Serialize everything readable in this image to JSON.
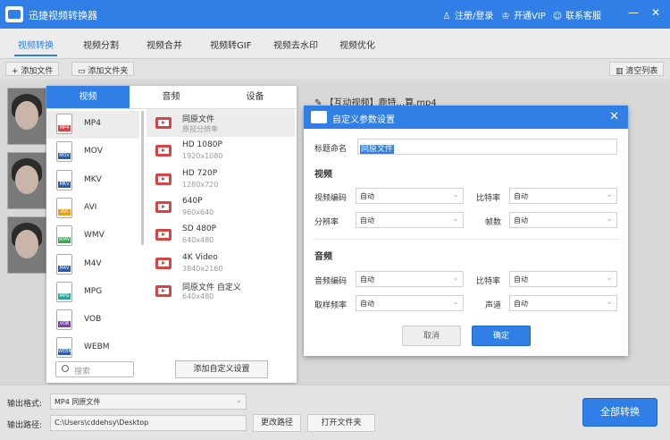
{
  "app": {
    "title": "迅捷视频转换器",
    "login": "注册/登录",
    "vip": "开通VIP",
    "service": "联系客服",
    "win_min": "—",
    "win_close": "✕"
  },
  "nav_tabs": [
    "视频转换",
    "视频分割",
    "视频合并",
    "视频转GIF",
    "视频去水印",
    "视频优化"
  ],
  "toolbar": {
    "add_file": "添加文件",
    "add_folder": "添加文件夹",
    "clear_list": "清空列表"
  },
  "file": {
    "name": "【互动视频】鹿特...算.mp4"
  },
  "format_panel": {
    "tabs": [
      "视频",
      "音频",
      "设备"
    ],
    "formats": [
      {
        "label": "MP4",
        "color": "#d64545"
      },
      {
        "label": "MOV",
        "color": "#2a5fa8"
      },
      {
        "label": "MKV",
        "color": "#2a5fa8"
      },
      {
        "label": "AVI",
        "color": "#e8a020"
      },
      {
        "label": "WMV",
        "color": "#3aa854"
      },
      {
        "label": "M4V",
        "color": "#2a5fa8"
      },
      {
        "label": "MPG",
        "color": "#2aa8a0"
      },
      {
        "label": "VOB",
        "color": "#7a3fb8"
      },
      {
        "label": "WEBM",
        "color": "#2a5fa8"
      }
    ],
    "presets": [
      {
        "name": "同原文件",
        "sub": "原视分辨率"
      },
      {
        "name": "HD 1080P",
        "sub": "1920x1080"
      },
      {
        "name": "HD 720P",
        "sub": "1280x720"
      },
      {
        "name": "640P",
        "sub": "960x640"
      },
      {
        "name": "SD 480P",
        "sub": "640x480"
      },
      {
        "name": "4K Video",
        "sub": "3840x2160"
      },
      {
        "name": "同原文件 自定义",
        "sub": "640x480"
      }
    ],
    "search_placeholder": "搜索",
    "add_custom": "添加自定义设置"
  },
  "dialog": {
    "title": "自定义参数设置",
    "title_label": "标题命名",
    "title_value": "同原文件",
    "video_section": "视频",
    "video_codec_label": "视频编码",
    "video_codec": "自动",
    "bitrate_label": "比特率",
    "bitrate": "自动",
    "resolution_label": "分辨率",
    "resolution": "自动",
    "framerate_label": "帧数",
    "framerate": "自动",
    "audio_section": "音频",
    "audio_codec_label": "音频编码",
    "audio_codec": "自动",
    "audio_bitrate_label": "比特率",
    "audio_bitrate": "自动",
    "samplerate_label": "取样频率",
    "samplerate": "自动",
    "channel_label": "声道",
    "channel": "自动",
    "cancel": "取消",
    "ok": "确定"
  },
  "bottom": {
    "format_label": "输出格式:",
    "format_value": "MP4  同原文件",
    "path_label": "输出路径:",
    "path_value": "C:\\Users\\cddehsy\\Desktop",
    "change_path": "更改路径",
    "open_folder": "打开文件夹",
    "convert_all": "全部转换"
  },
  "colors": {
    "accent": "#2f7fe6"
  }
}
